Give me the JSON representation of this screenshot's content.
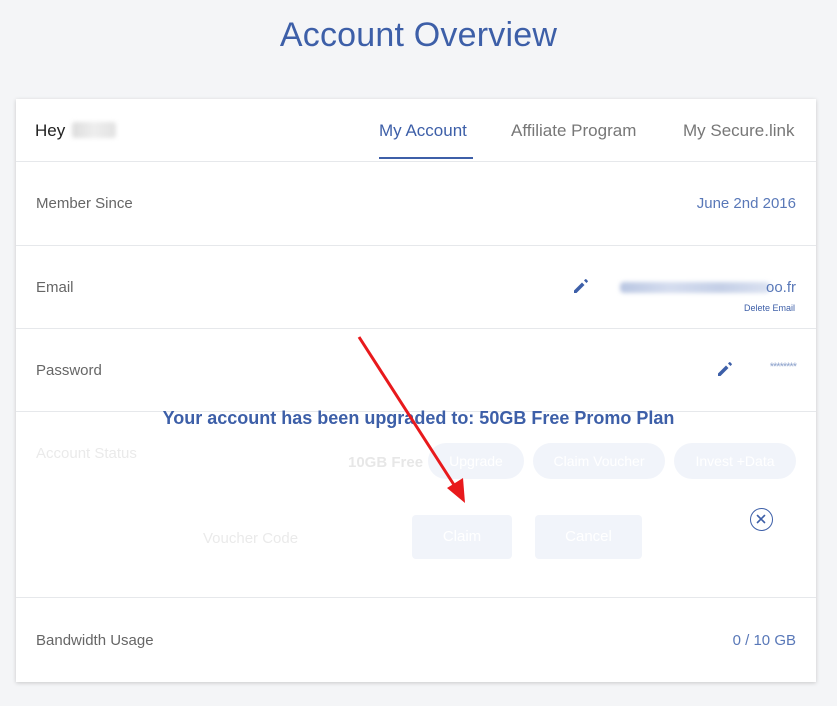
{
  "page_title": "Account Overview",
  "header": {
    "greeting": "Hey",
    "tabs": [
      {
        "label": "My Account",
        "active": true
      },
      {
        "label": "Affiliate Program",
        "active": false
      },
      {
        "label": "My Secure.link",
        "active": false
      }
    ]
  },
  "rows": {
    "member_since": {
      "label": "Member Since",
      "value": "June 2nd 2016"
    },
    "email": {
      "label": "Email",
      "value_visible_tail": "oo.fr",
      "delete_label": "Delete Email"
    },
    "password": {
      "label": "Password",
      "value": "********"
    },
    "account_status": {
      "label": "Account Status",
      "plan": "10GB Free",
      "buttons": [
        "Upgrade",
        "Claim Voucher",
        "Invest +Data"
      ],
      "voucher_label": "Voucher Code",
      "claim_label": "Claim",
      "cancel_label": "Cancel"
    },
    "bandwidth": {
      "label": "Bandwidth Usage",
      "value": "0 / 10 GB"
    }
  },
  "notification": {
    "message": "Your account has been upgraded to: 50GB Free Promo Plan",
    "close_icon": "close-circle-icon"
  },
  "colors": {
    "accent": "#3d5fa8",
    "annotation_arrow": "#e8191c"
  }
}
